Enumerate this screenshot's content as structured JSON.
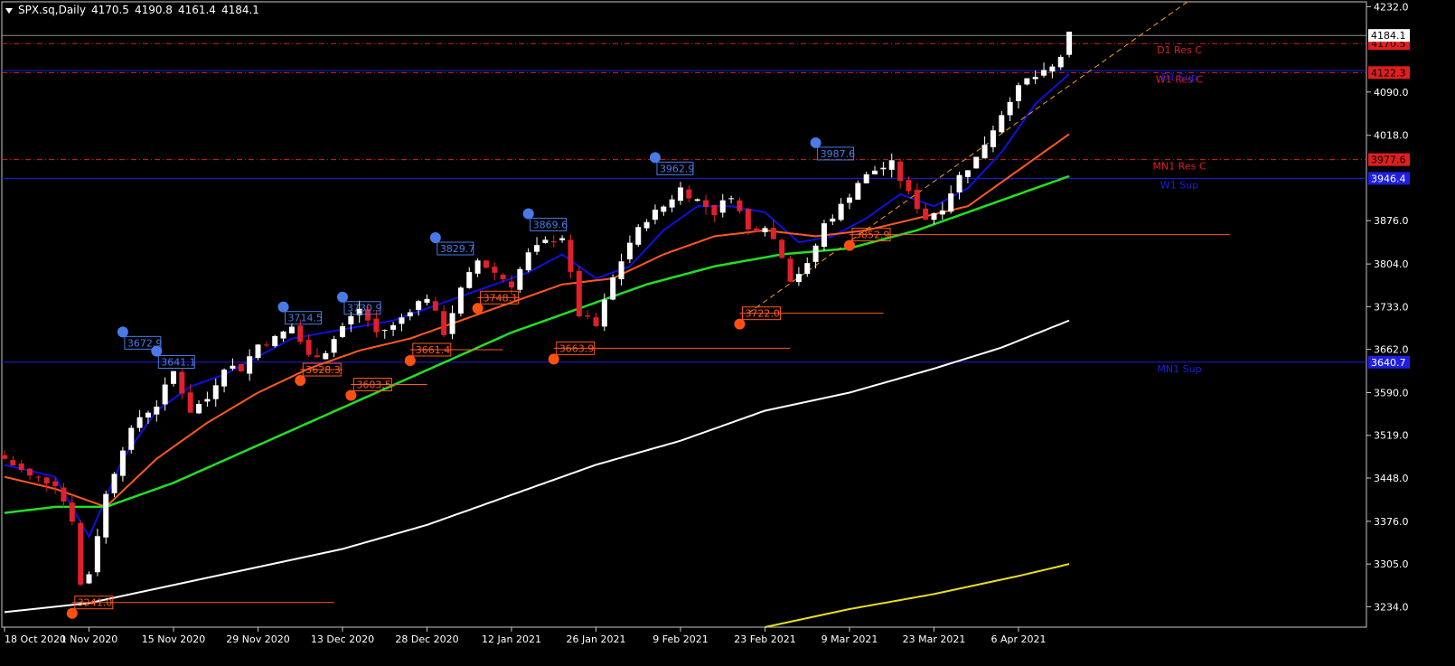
{
  "window": {
    "symbol": "SPX.sq,Daily",
    "ohlc": [
      "4170.5",
      "4190.8",
      "4161.4",
      "4184.1"
    ]
  },
  "colors": {
    "background": "#000000",
    "bull": "#ffffff",
    "bear": "#e0202a",
    "ma_fast": "#1010e0",
    "ma_mid": "#ff5a1e",
    "ma_slow": "#22e022",
    "ma_long": "#ffffff",
    "ma_longest": "#e6e01e",
    "res": "#e01e1e",
    "sup": "#1e1ee6",
    "fib_orange": "#ff5a1e",
    "trend": "#f0a020",
    "marker_high": "#4a7ae6",
    "marker_low": "#ff5014"
  },
  "chart_data": {
    "type": "candlestick",
    "price_axis": {
      "min": 3200,
      "max": 4240,
      "ticks": [
        "4232.0",
        "4090.0",
        "4018.0",
        "3876.0",
        "3804.0",
        "3733.0",
        "3662.0",
        "3590.0",
        "3519.0",
        "3448.0",
        "3376.0",
        "3305.0",
        "3234.0"
      ]
    },
    "date_axis": {
      "bars": 135,
      "labels": [
        {
          "bar": 0,
          "text": "18 Oct 2020"
        },
        {
          "bar": 10,
          "text": "1 Nov 2020"
        },
        {
          "bar": 20,
          "text": "15 Nov 2020"
        },
        {
          "bar": 30,
          "text": "29 Nov 2020"
        },
        {
          "bar": 40,
          "text": "13 Dec 2020"
        },
        {
          "bar": 50,
          "text": "28 Dec 2020"
        },
        {
          "bar": 60,
          "text": "12 Jan 2021"
        },
        {
          "bar": 70,
          "text": "26 Jan 2021"
        },
        {
          "bar": 80,
          "text": "9 Feb 2021"
        },
        {
          "bar": 90,
          "text": "23 Feb 2021"
        },
        {
          "bar": 100,
          "text": "9 Mar 2021"
        },
        {
          "bar": 110,
          "text": "23 Mar 2021"
        },
        {
          "bar": 120,
          "text": "6 Apr 2021"
        }
      ]
    },
    "close_path": [
      [
        0,
        3480
      ],
      [
        3,
        3450
      ],
      [
        6,
        3440
      ],
      [
        8,
        3380
      ],
      [
        9,
        3270
      ],
      [
        10,
        3290
      ],
      [
        12,
        3420
      ],
      [
        14,
        3500
      ],
      [
        16,
        3550
      ],
      [
        18,
        3570
      ],
      [
        20,
        3625
      ],
      [
        22,
        3560
      ],
      [
        24,
        3580
      ],
      [
        26,
        3635
      ],
      [
        28,
        3630
      ],
      [
        30,
        3670
      ],
      [
        32,
        3680
      ],
      [
        34,
        3700
      ],
      [
        36,
        3650
      ],
      [
        38,
        3660
      ],
      [
        40,
        3700
      ],
      [
        42,
        3730
      ],
      [
        44,
        3690
      ],
      [
        46,
        3700
      ],
      [
        48,
        3730
      ],
      [
        50,
        3750
      ],
      [
        52,
        3690
      ],
      [
        54,
        3760
      ],
      [
        56,
        3810
      ],
      [
        58,
        3790
      ],
      [
        60,
        3770
      ],
      [
        62,
        3820
      ],
      [
        64,
        3840
      ],
      [
        66,
        3850
      ],
      [
        68,
        3720
      ],
      [
        70,
        3700
      ],
      [
        72,
        3780
      ],
      [
        74,
        3840
      ],
      [
        76,
        3880
      ],
      [
        78,
        3900
      ],
      [
        80,
        3930
      ],
      [
        82,
        3910
      ],
      [
        84,
        3890
      ],
      [
        86,
        3920
      ],
      [
        88,
        3860
      ],
      [
        90,
        3870
      ],
      [
        92,
        3820
      ],
      [
        93,
        3780
      ],
      [
        95,
        3800
      ],
      [
        97,
        3870
      ],
      [
        99,
        3900
      ],
      [
        101,
        3940
      ],
      [
        103,
        3960
      ],
      [
        105,
        3970
      ],
      [
        107,
        3920
      ],
      [
        109,
        3880
      ],
      [
        111,
        3900
      ],
      [
        113,
        3950
      ],
      [
        115,
        3980
      ],
      [
        117,
        4030
      ],
      [
        119,
        4080
      ],
      [
        121,
        4110
      ],
      [
        123,
        4120
      ],
      [
        124,
        4130
      ],
      [
        125,
        4150
      ],
      [
        126,
        4184
      ]
    ],
    "series": [
      {
        "name": "",
        "color_key": "ma_fast",
        "points": [
          [
            0,
            3470
          ],
          [
            6,
            3450
          ],
          [
            10,
            3350
          ],
          [
            14,
            3480
          ],
          [
            18,
            3560
          ],
          [
            22,
            3600
          ],
          [
            26,
            3620
          ],
          [
            30,
            3650
          ],
          [
            34,
            3680
          ],
          [
            38,
            3690
          ],
          [
            42,
            3700
          ],
          [
            46,
            3710
          ],
          [
            50,
            3730
          ],
          [
            54,
            3750
          ],
          [
            58,
            3770
          ],
          [
            62,
            3790
          ],
          [
            66,
            3820
          ],
          [
            70,
            3780
          ],
          [
            74,
            3800
          ],
          [
            78,
            3860
          ],
          [
            82,
            3900
          ],
          [
            86,
            3900
          ],
          [
            90,
            3890
          ],
          [
            94,
            3840
          ],
          [
            98,
            3850
          ],
          [
            102,
            3880
          ],
          [
            106,
            3920
          ],
          [
            110,
            3900
          ],
          [
            114,
            3930
          ],
          [
            118,
            3990
          ],
          [
            122,
            4070
          ],
          [
            126,
            4120
          ]
        ]
      },
      {
        "name": "",
        "color_key": "ma_mid",
        "points": [
          [
            0,
            3450
          ],
          [
            6,
            3430
          ],
          [
            12,
            3400
          ],
          [
            18,
            3480
          ],
          [
            24,
            3540
          ],
          [
            30,
            3590
          ],
          [
            36,
            3630
          ],
          [
            42,
            3660
          ],
          [
            48,
            3680
          ],
          [
            54,
            3710
          ],
          [
            60,
            3740
          ],
          [
            66,
            3770
          ],
          [
            72,
            3780
          ],
          [
            78,
            3820
          ],
          [
            84,
            3850
          ],
          [
            90,
            3860
          ],
          [
            96,
            3850
          ],
          [
            102,
            3860
          ],
          [
            108,
            3880
          ],
          [
            114,
            3900
          ],
          [
            120,
            3960
          ],
          [
            126,
            4020
          ]
        ]
      },
      {
        "name": "",
        "color_key": "ma_slow",
        "points": [
          [
            0,
            3390
          ],
          [
            6,
            3400
          ],
          [
            12,
            3400
          ],
          [
            20,
            3440
          ],
          [
            28,
            3490
          ],
          [
            36,
            3540
          ],
          [
            44,
            3590
          ],
          [
            52,
            3640
          ],
          [
            60,
            3690
          ],
          [
            68,
            3730
          ],
          [
            76,
            3770
          ],
          [
            84,
            3800
          ],
          [
            92,
            3820
          ],
          [
            100,
            3830
          ],
          [
            108,
            3860
          ],
          [
            116,
            3900
          ],
          [
            126,
            3950
          ]
        ]
      },
      {
        "name": "",
        "color_key": "ma_long",
        "points": [
          [
            0,
            3225
          ],
          [
            10,
            3240
          ],
          [
            20,
            3270
          ],
          [
            30,
            3300
          ],
          [
            40,
            3330
          ],
          [
            50,
            3370
          ],
          [
            60,
            3420
          ],
          [
            70,
            3470
          ],
          [
            80,
            3510
          ],
          [
            90,
            3560
          ],
          [
            100,
            3590
          ],
          [
            110,
            3630
          ],
          [
            118,
            3665
          ],
          [
            126,
            3710
          ]
        ]
      },
      {
        "name": "",
        "color_key": "ma_longest",
        "points": [
          [
            90,
            3200
          ],
          [
            100,
            3230
          ],
          [
            110,
            3255
          ],
          [
            120,
            3285
          ],
          [
            126,
            3305
          ]
        ]
      }
    ],
    "levels": [
      {
        "label": "D1 Res C",
        "value": 4170.5,
        "price_tag": "4170.5",
        "color_key": "res",
        "style": "dashdot"
      },
      {
        "label": "W1 Res C",
        "value": 4122.3,
        "price_tag": "4122.3",
        "color_key": "res",
        "style": "dashdot"
      },
      {
        "label": "D1 Sup",
        "value": 4125.5,
        "price_tag": "",
        "color_key": "sup",
        "style": "solid"
      },
      {
        "label": "MN1 Res C",
        "value": 3977.6,
        "price_tag": "3977.6",
        "color_key": "res",
        "style": "dashdot"
      },
      {
        "label": "W1 Sup",
        "value": 3946.4,
        "price_tag": "3946.4",
        "color_key": "sup",
        "style": "solid"
      },
      {
        "label": "MN1 Sup",
        "value": 3640.7,
        "price_tag": "3640.7",
        "color_key": "sup",
        "style": "solid"
      }
    ],
    "current_price": {
      "value": 4184.1,
      "tag": "4184.1"
    },
    "swing_highs": [
      {
        "bar": 14,
        "value": 3672.9,
        "label": "3672.9"
      },
      {
        "bar": 18,
        "value": 3641.1,
        "label": "3641.1"
      },
      {
        "bar": 33,
        "value": 3714.5,
        "label": "3714.5"
      },
      {
        "bar": 40,
        "value": 3730.9,
        "label": "3730.9"
      },
      {
        "bar": 51,
        "value": 3829.7,
        "label": "3829.7"
      },
      {
        "bar": 62,
        "value": 3869.6,
        "label": "3869.6"
      },
      {
        "bar": 77,
        "value": 3962.9,
        "label": "3962.9"
      },
      {
        "bar": 96,
        "value": 3987.6,
        "label": "3987.6"
      }
    ],
    "swing_lows": [
      {
        "bar": 8,
        "value": 3241.0,
        "label": "3241.0",
        "line_to": 39
      },
      {
        "bar": 35,
        "value": 3628.3,
        "label": "3628.3",
        "line_to": 40
      },
      {
        "bar": 41,
        "value": 3603.5,
        "label": "3603.5",
        "line_to": 50
      },
      {
        "bar": 48,
        "value": 3661.4,
        "label": "3661.4",
        "line_to": 59
      },
      {
        "bar": 56,
        "value": 3748.1,
        "label": "3748.1",
        "line_to": 61
      },
      {
        "bar": 65,
        "value": 3663.9,
        "label": "3663.9",
        "line_to": 93
      },
      {
        "bar": 87,
        "value": 3722.0,
        "label": "3722.0",
        "line_to": 104
      },
      {
        "bar": 100,
        "value": 3852.9,
        "label": "3852.9",
        "line_to": 145
      }
    ],
    "trendline": {
      "from": [
        88,
        3722
      ],
      "to": [
        140,
        4240
      ]
    }
  }
}
